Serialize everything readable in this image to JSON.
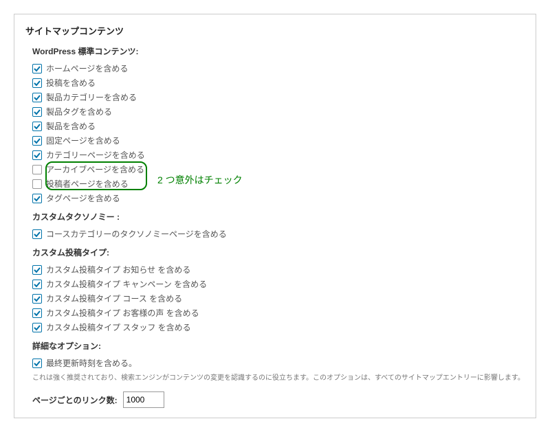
{
  "panel": {
    "title": "サイトマップコンテンツ"
  },
  "sections": {
    "wp_standard": {
      "title": "WordPress 標準コンテンツ:",
      "options": [
        {
          "label": "ホームページを含める",
          "checked": true
        },
        {
          "label": "投稿を含める",
          "checked": true
        },
        {
          "label": "製品カテゴリーを含める",
          "checked": true
        },
        {
          "label": "製品タグを含める",
          "checked": true
        },
        {
          "label": "製品を含める",
          "checked": true
        },
        {
          "label": "固定ページを含める",
          "checked": true
        },
        {
          "label": "カテゴリーページを含める",
          "checked": true
        },
        {
          "label": "アーカイブページを含める",
          "checked": false
        },
        {
          "label": "投稿者ページを含める",
          "checked": false
        },
        {
          "label": "タグページを含める",
          "checked": true
        }
      ]
    },
    "custom_tax": {
      "title": "カスタムタクソノミー :",
      "options": [
        {
          "label": "コースカテゴリーのタクソノミーページを含める",
          "checked": true
        }
      ]
    },
    "custom_post": {
      "title": "カスタム投稿タイプ:",
      "options": [
        {
          "label": "カスタム投稿タイプ お知らせ を含める",
          "checked": true
        },
        {
          "label": "カスタム投稿タイプ キャンペーン を含める",
          "checked": true
        },
        {
          "label": "カスタム投稿タイプ コース を含める",
          "checked": true
        },
        {
          "label": "カスタム投稿タイプ お客様の声 を含める",
          "checked": true
        },
        {
          "label": "カスタム投稿タイプ スタッフ を含める",
          "checked": true
        }
      ]
    },
    "advanced": {
      "title": "詳細なオプション:",
      "options": [
        {
          "label": "最終更新時刻を含める。",
          "checked": true
        }
      ],
      "note": "これは強く推奨されており、検索エンジンがコンテンツの変更を認識するのに役立ちます。このオプションは、すべてのサイトマップエントリーに影響します。"
    }
  },
  "links_per_page": {
    "label": "ページごとのリンク数:",
    "value": "1000"
  },
  "callout": {
    "text": "2 つ意外はチェック"
  }
}
